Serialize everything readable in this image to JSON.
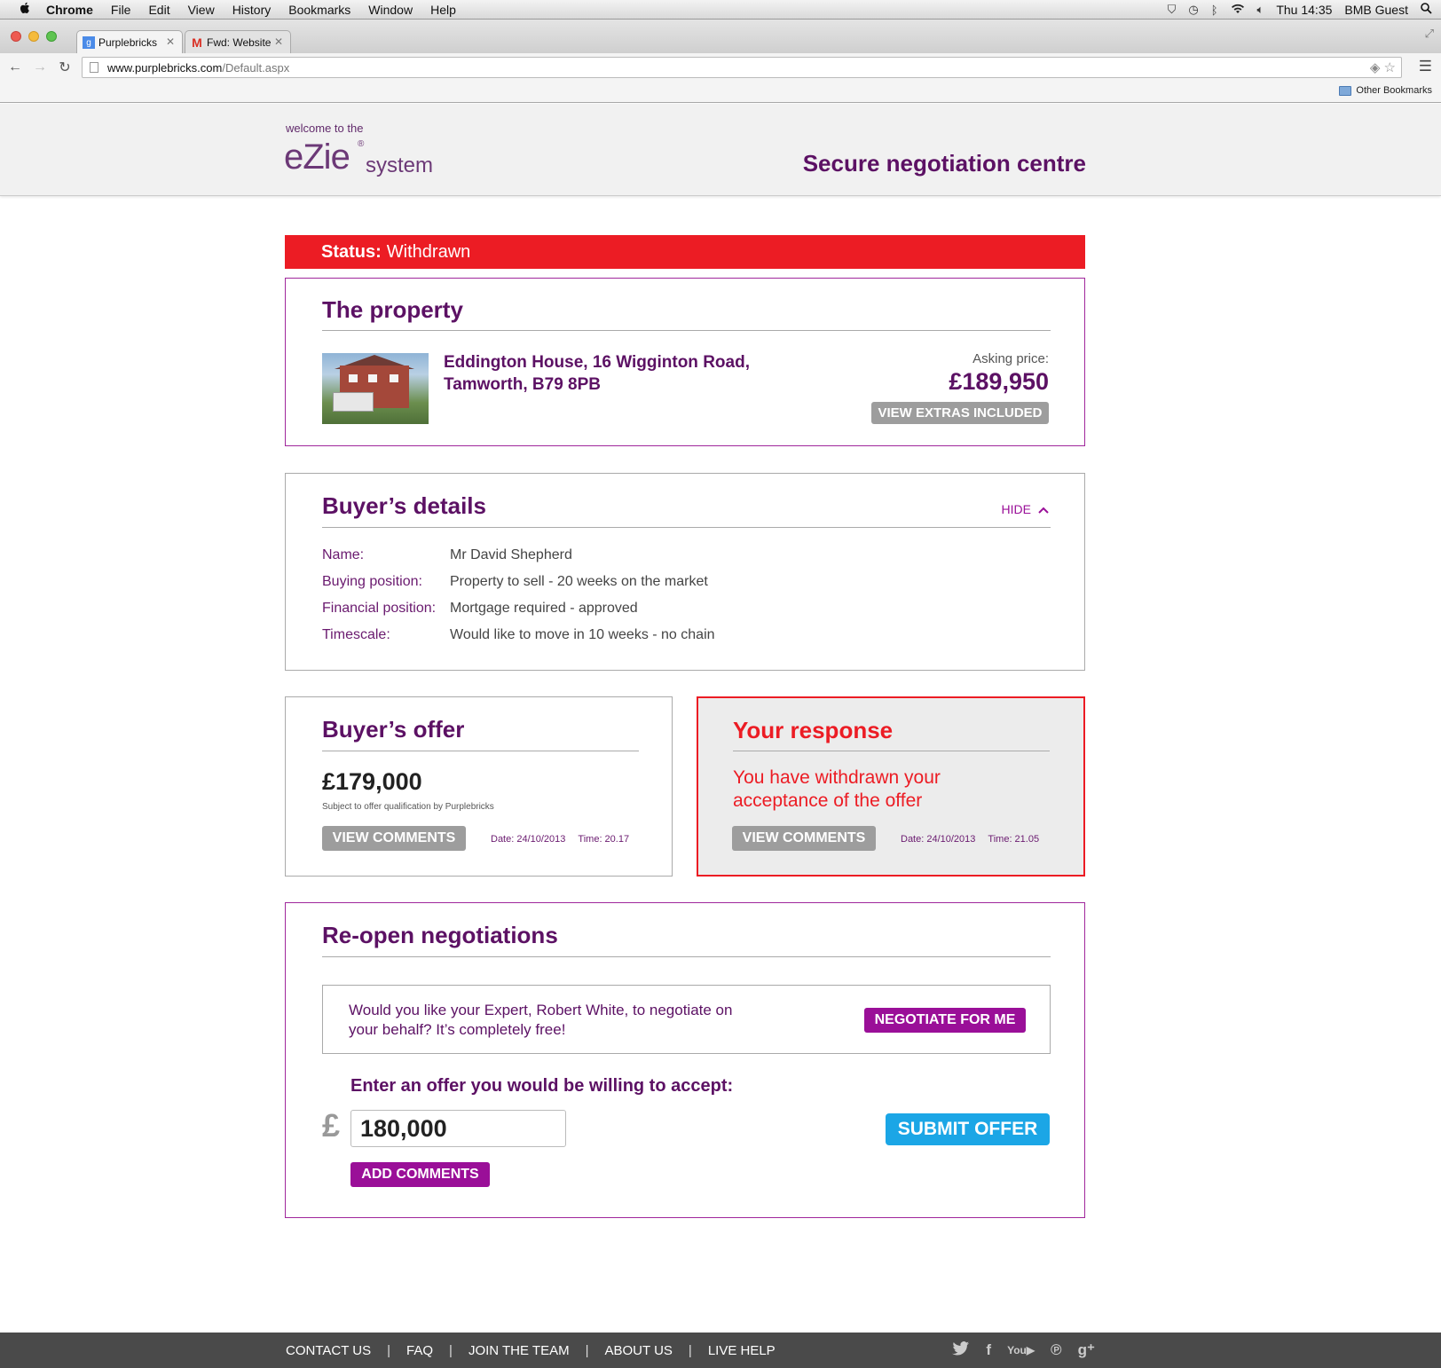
{
  "os_menubar": {
    "apple": "",
    "items": [
      "Chrome",
      "File",
      "Edit",
      "View",
      "History",
      "Bookmarks",
      "Window",
      "Help"
    ],
    "clock": "Thu 14:35",
    "user": "BMB Guest"
  },
  "browser": {
    "tabs": [
      {
        "title": "Purplebricks",
        "active": true
      },
      {
        "title": "Fwd: Website",
        "active": false
      }
    ],
    "url_host": "www.purplebricks.com",
    "url_path": "/Default.aspx",
    "other_bookmarks": "Other Bookmarks"
  },
  "header": {
    "welcome": "welcome to the",
    "logo_main": "eZie",
    "logo_reg": "®",
    "logo_sub": "system",
    "title": "Secure negotiation centre"
  },
  "status": {
    "label": "Status:",
    "value": "Withdrawn",
    "color": "#ec1c24"
  },
  "property": {
    "heading": "The property",
    "address_line1": "Eddington House, 16 Wigginton Road,",
    "address_line2": "Tamworth, B79 8PB",
    "asking_label": "Asking price:",
    "asking_price": "£189,950",
    "extras_button": "VIEW EXTRAS INCLUDED"
  },
  "buyer_details": {
    "heading": "Buyer’s details",
    "hide": "HIDE",
    "rows": [
      {
        "label": "Name:",
        "value": "Mr David Shepherd"
      },
      {
        "label": "Buying position:",
        "value": "Property to sell - 20 weeks on the market"
      },
      {
        "label": "Financial position:",
        "value": "Mortgage required - approved"
      },
      {
        "label": "Timescale:",
        "value": "Would like to move in 10 weeks - no chain"
      }
    ]
  },
  "buyer_offer": {
    "heading": "Buyer’s offer",
    "amount": "£179,000",
    "note": "Subject to offer qualification by Purplebricks",
    "comments_button": "VIEW COMMENTS",
    "date": "Date: 24/10/2013",
    "time": "Time: 20.17"
  },
  "your_response": {
    "heading": "Your response",
    "message_line1": "You have withdrawn your",
    "message_line2": "acceptance of the offer",
    "comments_button": "VIEW COMMENTS",
    "date": "Date: 24/10/2013",
    "time": "Time: 21.05"
  },
  "reopen": {
    "heading": "Re-open negotiations",
    "expert_line1": "Would you like your Expert, Robert White, to negotiate on",
    "expert_line2": "your behalf? It’s completely free!",
    "negotiate_button": "NEGOTIATE FOR ME",
    "enter_label": "Enter an offer you would be willing to accept:",
    "currency": "£",
    "offer_value": "180,000",
    "submit_button": "SUBMIT OFFER",
    "add_comments_button": "ADD COMMENTS"
  },
  "footer": {
    "links": [
      "CONTACT US",
      "FAQ",
      "JOIN THE TEAM",
      "ABOUT US",
      "LIVE HELP"
    ],
    "social": [
      "twitter-icon",
      "facebook-icon",
      "youtube-icon",
      "pinterest-icon",
      "google-plus-icon"
    ]
  },
  "colors": {
    "brand_purple": "#5c1164",
    "accent_magenta": "#9a0f98",
    "alert_red": "#ec1c24",
    "submit_blue": "#1ba6e6"
  }
}
